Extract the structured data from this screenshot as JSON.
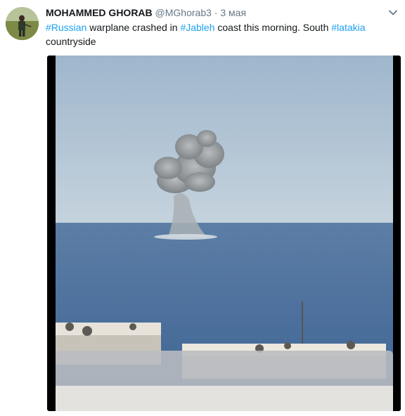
{
  "user": {
    "display_name": "MOHAMMED GHORAB",
    "handle": "@MGhorab3",
    "separator": "·",
    "date": "3 мая"
  },
  "tweet": {
    "hashtag1": "#Russian",
    "text1": " warplane crashed in ",
    "hashtag2": "#Jableh",
    "text2": " coast this morning. South ",
    "hashtag3": "#latakia",
    "text3": " countryside"
  },
  "icons": {
    "menu": "chevron-down-icon",
    "avatar": "user-avatar"
  },
  "colors": {
    "link": "#1da1f2",
    "muted": "#657786",
    "text": "#14171a"
  }
}
